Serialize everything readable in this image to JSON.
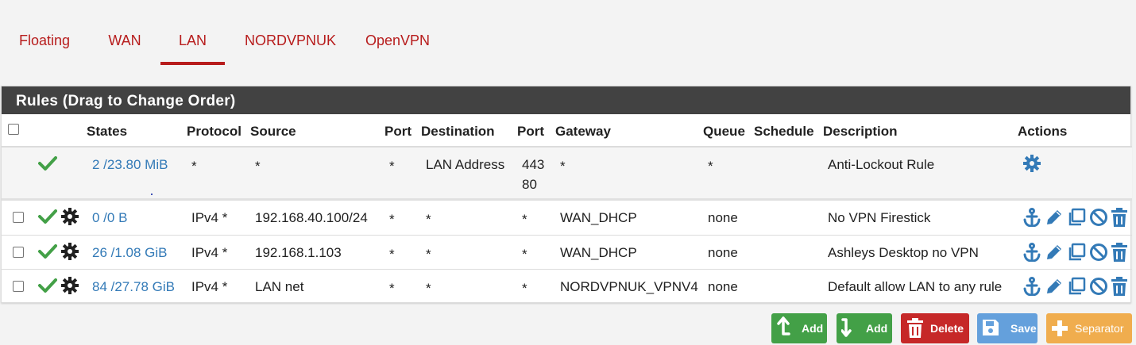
{
  "tabs": [
    {
      "label": "Floating",
      "active": false
    },
    {
      "label": "WAN",
      "active": false
    },
    {
      "label": "LAN",
      "active": true
    },
    {
      "label": "NORDVPNUK",
      "active": false
    },
    {
      "label": "OpenVPN",
      "active": false
    }
  ],
  "panel": {
    "title": "Rules (Drag to Change Order)"
  },
  "columns": [
    "States",
    "Protocol",
    "Source",
    "Port",
    "Destination",
    "Port",
    "Gateway",
    "Queue",
    "Schedule",
    "Description",
    "Actions"
  ],
  "anti_lockout": {
    "states": "2 /23.80 MiB",
    "protocol": "*",
    "source": "*",
    "port": "*",
    "destination": "LAN Address",
    "dest_port_1": "443",
    "dest_port_2": "80",
    "gateway": "*",
    "queue": "*",
    "description": "Anti-Lockout Rule"
  },
  "rules": [
    {
      "states": "0 /0 B",
      "protocol": "IPv4 *",
      "source": "192.168.40.100/24",
      "port": "*",
      "destination": "*",
      "dest_port": "*",
      "gateway": "WAN_DHCP",
      "queue": "none",
      "description": "No VPN Firestick"
    },
    {
      "states": "26 /1.08 GiB",
      "protocol": "IPv4 *",
      "source": "192.168.1.103",
      "port": "*",
      "destination": "*",
      "dest_port": "*",
      "gateway": "WAN_DHCP",
      "queue": "none",
      "description": "Ashleys Desktop no VPN"
    },
    {
      "states": "84 /27.78 GiB",
      "protocol": "IPv4 *",
      "source": "LAN net",
      "port": "*",
      "destination": "*",
      "dest_port": "*",
      "gateway": "NORDVPNUK_VPNV4",
      "queue": "none",
      "description": "Default allow LAN to any rule"
    }
  ],
  "buttons": {
    "add_top": "Add",
    "add_bottom": "Add",
    "delete": "Delete",
    "save": "Save",
    "separator": "Separator"
  },
  "colors": {
    "accent": "#b71c1c",
    "link": "#337ab7",
    "check": "#43a047",
    "green_button": "#43a047",
    "red_button": "#c62828",
    "blue_button": "#64a0dc",
    "orange_button": "#f0ad4e"
  },
  "icons": {
    "enabled": "check-icon",
    "advanced": "gear-icon",
    "anchor": "anchor-icon",
    "edit": "pencil-icon",
    "copy": "copy-icon",
    "disable": "disable-icon",
    "delete": "trash-icon"
  }
}
